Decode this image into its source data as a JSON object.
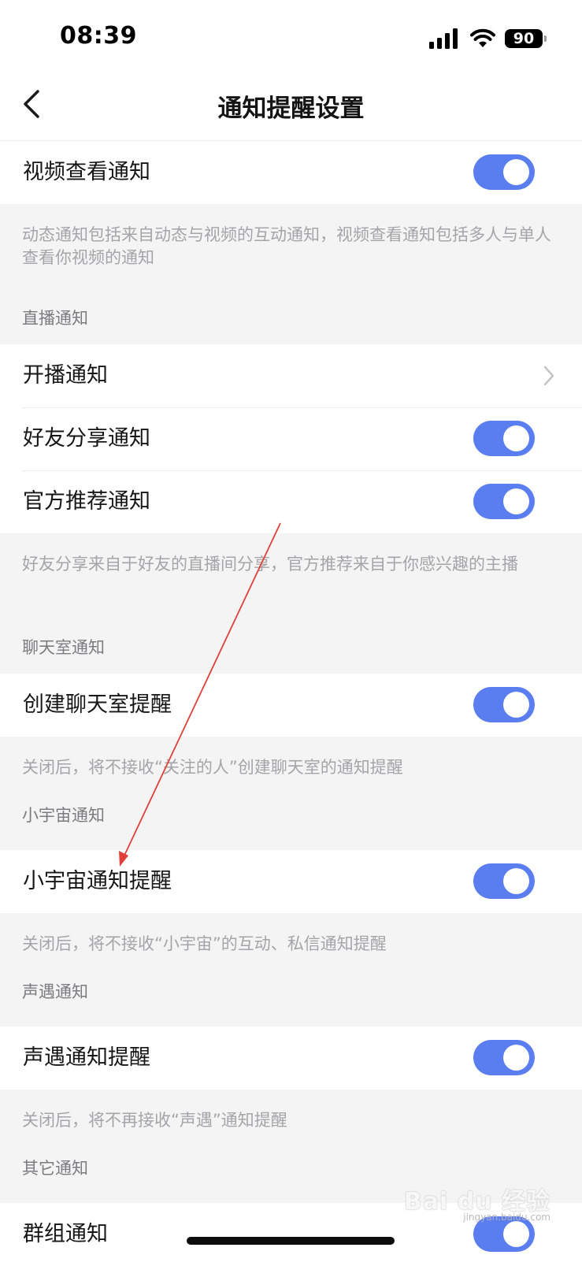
{
  "status_bar": {
    "time": "08:39",
    "battery": "90"
  },
  "nav": {
    "title": "通知提醒设置"
  },
  "items": {
    "video_view": {
      "label": "视频查看通知",
      "on": true
    },
    "live_start": {
      "label": "开播通知"
    },
    "friend_share": {
      "label": "好友分享通知",
      "on": true
    },
    "official_recommend": {
      "label": "官方推荐通知",
      "on": true
    },
    "create_chatroom": {
      "label": "创建聊天室提醒",
      "on": true
    },
    "universe": {
      "label": "小宇宙通知提醒",
      "on": true
    },
    "voice_meet": {
      "label": "声遇通知提醒",
      "on": true
    },
    "group": {
      "label": "群组通知",
      "on": true
    }
  },
  "descriptions": {
    "dynamic": "动态通知包括来自动态与视频的互动通知，视频查看通知包括多人与单人查看你视频的通知",
    "live": "好友分享来自于好友的直播间分享，官方推荐来自于你感兴趣的主播",
    "chatroom": "关闭后，将不接收“关注的人”创建聊天室的通知提醒",
    "universe": "关闭后，将不接收“小宇宙”的互动、私信通知提醒",
    "voice_meet": "关闭后，将不再接收“声遇”通知提醒"
  },
  "sections": {
    "live": "直播通知",
    "chatroom": "聊天室通知",
    "universe": "小宇宙通知",
    "voice_meet": "声遇通知",
    "other": "其它通知"
  },
  "watermark": {
    "brand": "Bai du 经验",
    "url": "jingyan.baidu.com"
  },
  "colors": {
    "toggle_on": "#5a7ef0",
    "annotation_arrow": "#e0403a"
  }
}
